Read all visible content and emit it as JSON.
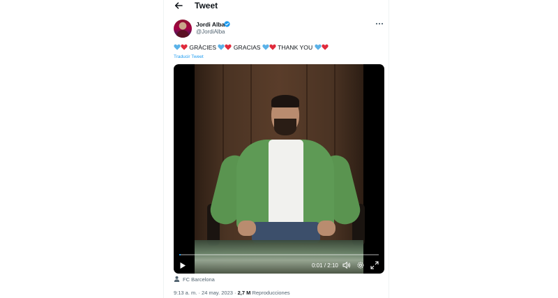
{
  "header": {
    "title": "Tweet",
    "back_icon": "back-arrow-icon"
  },
  "author": {
    "name": "Jordi Alba",
    "handle": "@JordiAlba",
    "verified": true,
    "verified_color": "#1d9bf0",
    "avatar_icon": "avatar"
  },
  "more_icon": "more-horizontal-icon",
  "tweet": {
    "segments": [
      "GRÀCIES",
      "GRACIAS",
      "THANK YOU"
    ],
    "heart_colors": [
      "#5bb2e8",
      "#e02b3c"
    ],
    "translate_label": "Traducir Tweet"
  },
  "video": {
    "progress_fraction": 0.005,
    "current_time": "0:01",
    "separator": "/",
    "duration": "2:10",
    "icons": [
      "play-icon",
      "volume-icon",
      "settings-icon",
      "fullscreen-icon"
    ]
  },
  "location": {
    "icon": "person-place-icon",
    "label": "FC Barcelona"
  },
  "meta": {
    "time": "9:13 a. m.",
    "date": "24 may. 2023",
    "views_count": "2,7 M",
    "views_label": "Reproducciones"
  },
  "colors": {
    "accent": "#1d9bf0",
    "secondary_text": "#536471",
    "primary_text": "#0f1419"
  }
}
